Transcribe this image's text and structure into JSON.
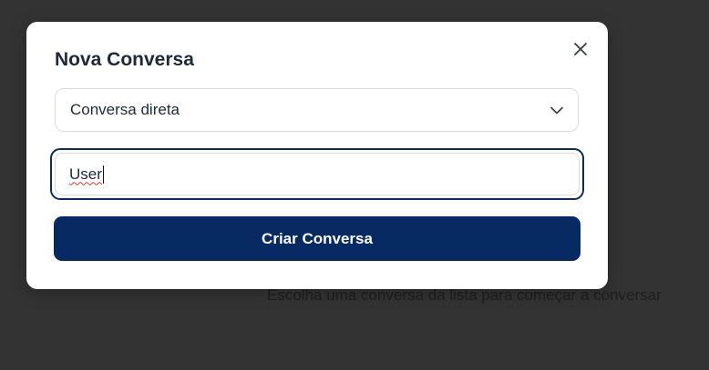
{
  "background": {
    "hint_text": "Escolha uma conversa da lista para começar a conversar"
  },
  "modal": {
    "title": "Nova Conversa",
    "close_icon": "close-icon",
    "type_select": {
      "selected": "Conversa direta",
      "icon": "chevron-down-icon"
    },
    "user_input": {
      "value": "User",
      "focused": true
    },
    "submit_label": "Criar Conversa"
  },
  "colors": {
    "primary": "#082a63",
    "backdrop": "#333333"
  }
}
